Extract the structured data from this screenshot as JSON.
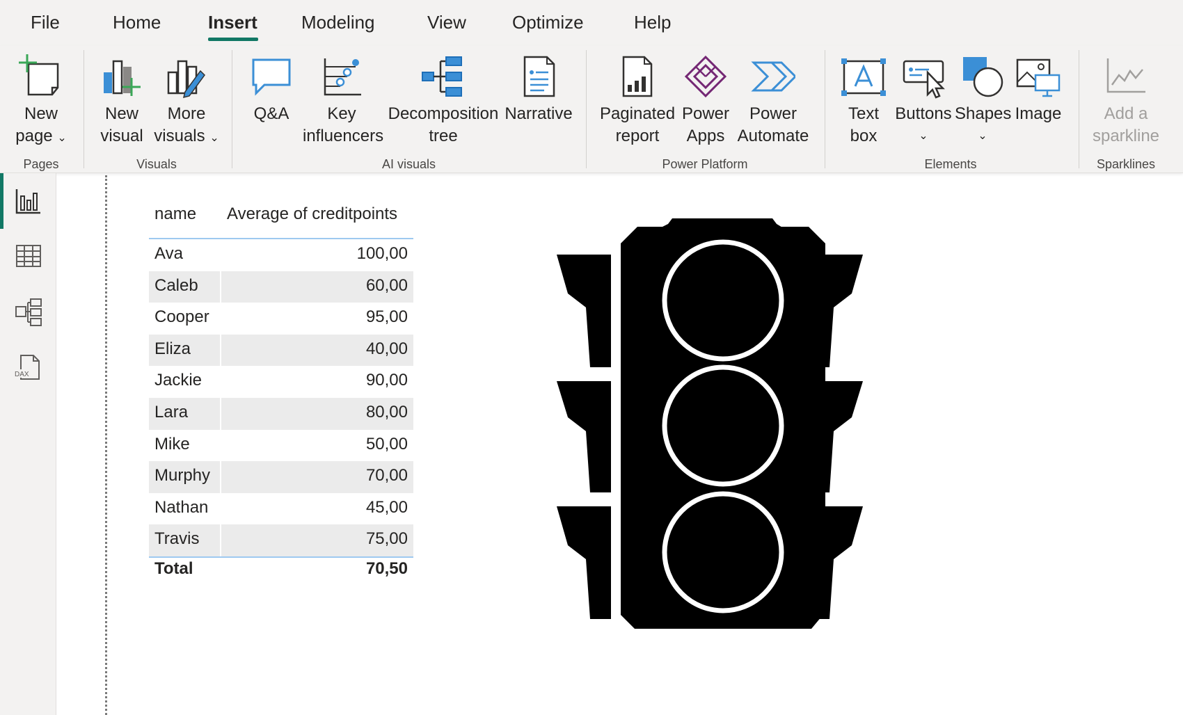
{
  "menu": {
    "items": [
      "File",
      "Home",
      "Insert",
      "Modeling",
      "View",
      "Optimize",
      "Help"
    ],
    "active": "Insert"
  },
  "ribbon": {
    "groups": {
      "pages": "Pages",
      "visuals": "Visuals",
      "ai_visuals": "AI visuals",
      "power_platform": "Power Platform",
      "elements": "Elements",
      "sparklines": "Sparklines"
    },
    "buttons": {
      "new_page": {
        "line1": "New",
        "line2": "page",
        "icon": "new-page-icon",
        "dropdown": true
      },
      "new_visual": {
        "line1": "New",
        "line2": "visual",
        "icon": "new-visual-icon"
      },
      "more_visuals": {
        "line1": "More",
        "line2": "visuals",
        "icon": "more-visuals-icon",
        "dropdown": true
      },
      "qa": {
        "line1": "Q&A",
        "icon": "qa-icon"
      },
      "key_influencers": {
        "line1": "Key",
        "line2": "influencers",
        "icon": "key-influencers-icon"
      },
      "decomposition_tree": {
        "line1": "Decomposition",
        "line2": "tree",
        "icon": "decomposition-tree-icon"
      },
      "narrative": {
        "line1": "Narrative",
        "icon": "narrative-icon"
      },
      "paginated_report": {
        "line1": "Paginated",
        "line2": "report",
        "icon": "paginated-report-icon"
      },
      "power_apps": {
        "line1": "Power",
        "line2": "Apps",
        "icon": "power-apps-icon"
      },
      "power_automate": {
        "line1": "Power",
        "line2": "Automate",
        "icon": "power-automate-icon"
      },
      "text_box": {
        "line1": "Text",
        "line2": "box",
        "icon": "text-box-icon"
      },
      "buttons": {
        "line1": "Buttons",
        "icon": "buttons-icon",
        "dropdown": true
      },
      "shapes": {
        "line1": "Shapes",
        "icon": "shapes-icon",
        "dropdown": true
      },
      "image": {
        "line1": "Image",
        "icon": "image-icon"
      },
      "add_sparkline": {
        "line1": "Add a",
        "line2": "sparkline",
        "icon": "sparkline-icon",
        "disabled": true
      }
    }
  },
  "leftnav": {
    "items": [
      "report-view-icon",
      "table-view-icon",
      "model-view-icon",
      "dax-query-view-icon"
    ],
    "active": "report-view-icon",
    "dax_label": "DAX"
  },
  "table": {
    "columns": [
      "name",
      "Average of creditpoints"
    ],
    "rows": [
      [
        "Ava",
        "100,00"
      ],
      [
        "Caleb",
        "60,00"
      ],
      [
        "Cooper",
        "95,00"
      ],
      [
        "Eliza",
        "40,00"
      ],
      [
        "Jackie",
        "90,00"
      ],
      [
        "Lara",
        "80,00"
      ],
      [
        "Mike",
        "50,00"
      ],
      [
        "Murphy",
        "70,00"
      ],
      [
        "Nathan",
        "45,00"
      ],
      [
        "Travis",
        "75,00"
      ]
    ],
    "total_label": "Total",
    "total_value": "70,50"
  },
  "image_visual": {
    "icon": "traffic-light-icon"
  },
  "colors": {
    "accent": "#117865",
    "ribbon_bg": "#f3f2f1",
    "icon_blue": "#3b8fd6",
    "power_apps": "#742774",
    "header_line": "#9ec9f0"
  }
}
